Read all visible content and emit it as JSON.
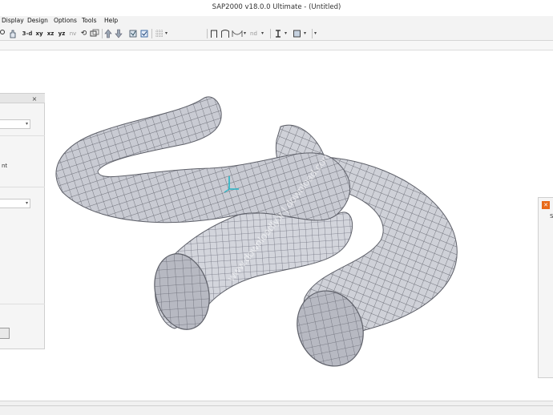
{
  "window": {
    "title": "SAP2000 v18.0.0 Ultimate  - (Untitled)"
  },
  "menu": {
    "items": [
      "Display",
      "Design",
      "Options",
      "Tools",
      "Help"
    ]
  },
  "toolbar": {
    "view_3d": "3-d",
    "view_xy": "xy",
    "view_xz": "xz",
    "view_yz": "yz",
    "view_nv": "nv",
    "nd": "nd"
  },
  "viewport": {
    "watermark": "www.downloadly.ir | download.com"
  },
  "left_panel": {
    "close": "×",
    "partial_label": "nt"
  },
  "right_panel": {
    "partial_label": "S"
  },
  "colors": {
    "mesh_fill": "#c9cbd3",
    "mesh_line": "#6e7079",
    "accent_icon": "#e86a1a"
  }
}
